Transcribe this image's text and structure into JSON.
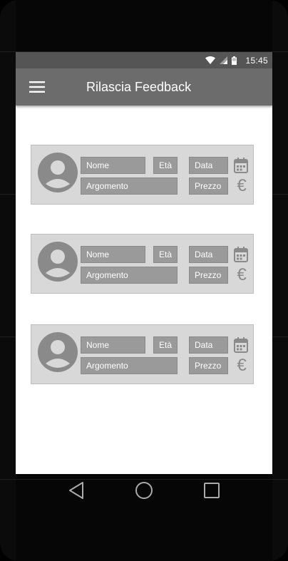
{
  "status_bar": {
    "time": "15:45"
  },
  "app_bar": {
    "title": "Rilascia Feedback"
  },
  "cards": [
    {
      "name_field": "Nome",
      "age_field": "Età",
      "date_field": "Data",
      "topic_field": "Argomento",
      "price_field": "Prezzo",
      "currency_symbol": "€"
    },
    {
      "name_field": "Nome",
      "age_field": "Età",
      "date_field": "Data",
      "topic_field": "Argomento",
      "price_field": "Prezzo",
      "currency_symbol": "€"
    },
    {
      "name_field": "Nome",
      "age_field": "Età",
      "date_field": "Data",
      "topic_field": "Argomento",
      "price_field": "Prezzo",
      "currency_symbol": "€"
    }
  ],
  "icons": {
    "status": [
      "wifi-icon",
      "signal-icon",
      "battery-icon"
    ],
    "app_bar": "menu-icon",
    "card": [
      "avatar-icon",
      "calendar-icon",
      "euro-icon"
    ],
    "nav": [
      "back-icon",
      "home-icon",
      "recents-icon"
    ]
  },
  "colors": {
    "status_bar": "#555555",
    "app_bar": "#6c6c6c",
    "card_background": "#d8d8d8",
    "field_background": "#9a9a9a",
    "icon_gray": "#8a8a8a"
  }
}
